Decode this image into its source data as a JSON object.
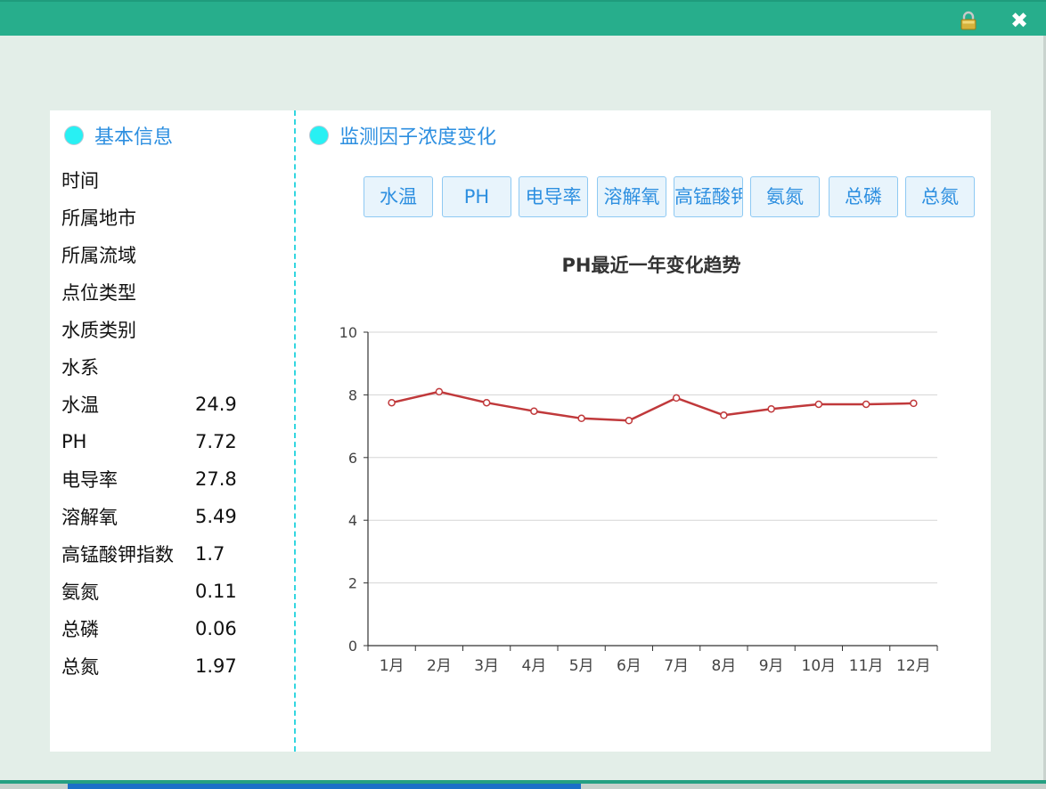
{
  "colors": {
    "titlebar": "#27ae8c",
    "accent": "#2d8fe0",
    "dot": "#28f0f3",
    "line": "#c0393b"
  },
  "window": {
    "lock_icon": "lock-icon",
    "close_icon": "close-icon",
    "close_glyph": "✖"
  },
  "basic_info": {
    "title": "基本信息",
    "rows": [
      {
        "label": "时间",
        "value": ""
      },
      {
        "label": "所属地市",
        "value": ""
      },
      {
        "label": "所属流域",
        "value": ""
      },
      {
        "label": "点位类型",
        "value": ""
      },
      {
        "label": "水质类别",
        "value": ""
      },
      {
        "label": "水系",
        "value": ""
      },
      {
        "label": "水温",
        "value": "24.9"
      },
      {
        "label": "PH",
        "value": "7.72"
      },
      {
        "label": "电导率",
        "value": "27.8"
      },
      {
        "label": "溶解氧",
        "value": "5.49"
      },
      {
        "label": "高锰酸钾指数",
        "value": "1.7"
      },
      {
        "label": "氨氮",
        "value": "0.11"
      },
      {
        "label": "总磷",
        "value": "0.06"
      },
      {
        "label": "总氮",
        "value": "1.97"
      }
    ]
  },
  "monitor": {
    "title": "监测因子浓度变化",
    "buttons": [
      "水温",
      "PH",
      "电导率",
      "溶解氧",
      "高锰酸钾指数",
      "氨氮",
      "总磷",
      "总氮"
    ]
  },
  "chart_data": {
    "type": "line",
    "title": "PH最近一年变化趋势",
    "categories": [
      "1月",
      "2月",
      "3月",
      "4月",
      "5月",
      "6月",
      "7月",
      "8月",
      "9月",
      "10月",
      "11月",
      "12月"
    ],
    "series": [
      {
        "values": [
          7.75,
          8.1,
          7.75,
          7.48,
          7.25,
          7.18,
          7.9,
          7.35,
          7.55,
          7.7,
          7.7,
          7.73
        ]
      }
    ],
    "ylim": [
      0,
      10
    ],
    "yticks": [
      0,
      2,
      4,
      6,
      8,
      10
    ],
    "grid": true,
    "line_color": "#c0393b"
  }
}
